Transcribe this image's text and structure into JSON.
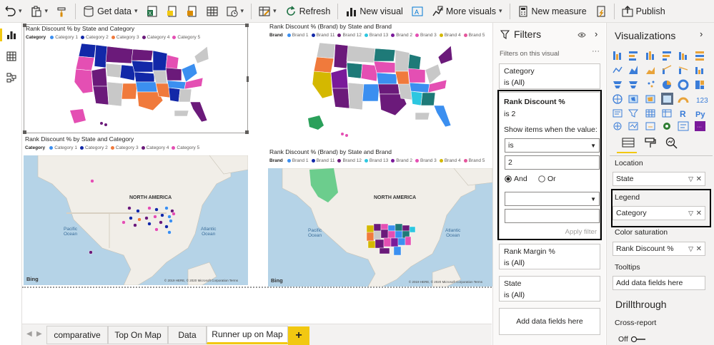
{
  "ribbon": {
    "get_data": "Get data",
    "refresh": "Refresh",
    "new_visual": "New visual",
    "more_visuals": "More visuals",
    "new_measure": "New measure",
    "publish": "Publish"
  },
  "visuals": {
    "v1": {
      "title": "Rank Discount % by State and Category",
      "legend_title": "Category",
      "legend": [
        {
          "label": "Category 1",
          "color": "#3b8ff0"
        },
        {
          "label": "Category 2",
          "color": "#1228a8"
        },
        {
          "label": "Category 3",
          "color": "#f07a3c"
        },
        {
          "label": "Category 4",
          "color": "#6b1a7a"
        },
        {
          "label": "Category 5",
          "color": "#e44fb3"
        }
      ]
    },
    "v2": {
      "title": "Rank Discount % (Brand) by State and Brand",
      "legend_title": "Brand",
      "legend": [
        {
          "label": "Brand 1",
          "color": "#3b8ff0"
        },
        {
          "label": "Brand 11",
          "color": "#1228a8"
        },
        {
          "label": "Brand 12",
          "color": "#6b1a7a"
        },
        {
          "label": "Brand 13",
          "color": "#2dc7e0"
        },
        {
          "label": "Brand 2",
          "color": "#7a1a9a"
        },
        {
          "label": "Brand 3",
          "color": "#e44fb3"
        },
        {
          "label": "Brand 4",
          "color": "#d4b800"
        },
        {
          "label": "Brand 5",
          "color": "#e4559b"
        }
      ]
    },
    "v3": {
      "title": "Rank Discount % by State and Category",
      "legend_title": "Category",
      "legend": [
        {
          "label": "Category 1",
          "color": "#3b8ff0"
        },
        {
          "label": "Category 2",
          "color": "#1228a8"
        },
        {
          "label": "Category 3",
          "color": "#f07a3c"
        },
        {
          "label": "Category 4",
          "color": "#6b1a7a"
        },
        {
          "label": "Category 5",
          "color": "#e44fb3"
        }
      ],
      "map_label": "NORTH AMERICA",
      "pacific": "Pacific\nOcean",
      "atlantic": "Atlantic\nOcean",
      "bing": "Bing",
      "copyright": "© 2019 HERE, © 2020 Microsoft Corporation Terms"
    },
    "v4": {
      "title": "Rank Discount % (Brand) by State and Brand",
      "legend_title": "Brand",
      "legend": [
        {
          "label": "Brand 1",
          "color": "#3b8ff0"
        },
        {
          "label": "Brand 11",
          "color": "#1228a8"
        },
        {
          "label": "Brand 12",
          "color": "#6b1a7a"
        },
        {
          "label": "Brand 13",
          "color": "#2dc7e0"
        },
        {
          "label": "Brand 2",
          "color": "#7a1a9a"
        },
        {
          "label": "Brand 3",
          "color": "#e44fb3"
        },
        {
          "label": "Brand 4",
          "color": "#d4b800"
        },
        {
          "label": "Brand 5",
          "color": "#e4559b"
        }
      ],
      "map_label": "NORTH AMERICA",
      "pacific": "Pacific\nOcean",
      "atlantic": "Atlantic\nOcean",
      "bing": "Bing",
      "copyright": "© 2019 HERE, © 2020 Microsoft Corporation Terms"
    }
  },
  "tabs": [
    "comparative",
    "Top On Map",
    "Data",
    "Runner up on Map"
  ],
  "active_tab": "Runner up on Map",
  "filters": {
    "title": "Filters",
    "on_this_visual": "Filters on this visual",
    "category": {
      "name": "Category",
      "value": "is (All)"
    },
    "rank_discount": {
      "name": "Rank Discount %",
      "value": "is 2",
      "show_items": "Show items when the value:",
      "operator": "is",
      "input": "2",
      "and": "And",
      "or": "Or",
      "apply": "Apply filter"
    },
    "rank_margin": {
      "name": "Rank Margin %",
      "value": "is (All)"
    },
    "state": {
      "name": "State",
      "value": "is (All)"
    },
    "add_fields": "Add data fields here"
  },
  "visualizations": {
    "title": "Visualizations",
    "location_label": "Location",
    "location_value": "State",
    "legend_label": "Legend",
    "legend_value": "Category",
    "color_saturation_label": "Color saturation",
    "color_saturation_value": "Rank Discount %",
    "tooltips_label": "Tooltips",
    "tooltips_placeholder": "Add data fields here",
    "drillthrough": "Drillthrough",
    "cross_report": "Cross-report",
    "off": "Off"
  }
}
